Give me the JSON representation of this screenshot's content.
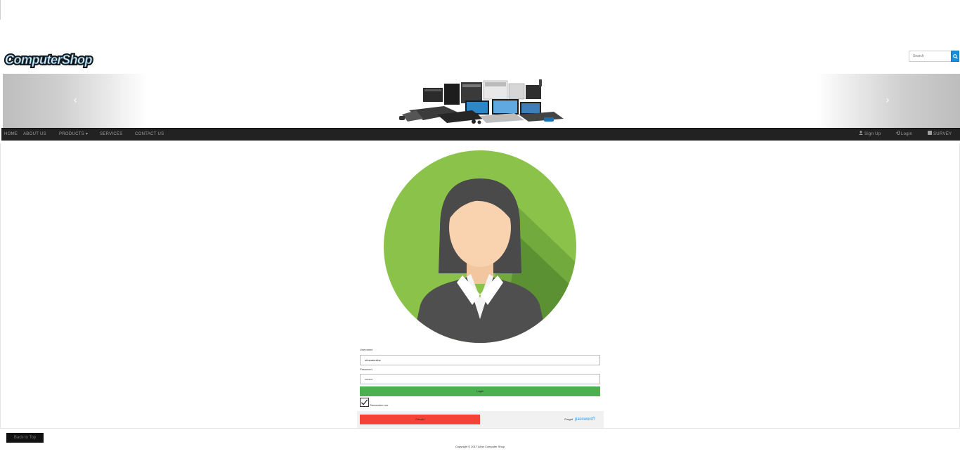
{
  "brand": {
    "logo_text": "ComputerShop"
  },
  "search": {
    "placeholder": "Search",
    "button_icon": "search-icon"
  },
  "carousel": {
    "prev_icon": "chevron-left-icon",
    "next_icon": "chevron-right-icon",
    "prev_glyph": "‹",
    "next_glyph": "›",
    "image": "computer-products-collage"
  },
  "navbar": {
    "left": [
      {
        "label": "HOME"
      },
      {
        "label": "ABOUT US"
      },
      {
        "label": "PRODUCTS ▾"
      },
      {
        "label": "SERVICES"
      },
      {
        "label": "CONTACT US"
      }
    ],
    "right": [
      {
        "label": "Sign Up",
        "icon": "user-icon"
      },
      {
        "label": "Login",
        "icon": "login-icon"
      },
      {
        "label": "SURVEY",
        "icon": "list-icon"
      }
    ]
  },
  "login": {
    "avatar": "woman-avatar",
    "username_label": "Username",
    "username_value": "ofmeateuline",
    "password_label": "Password",
    "password_value": "••••••••",
    "login_button": "Login",
    "remember_label": "Remember me",
    "remember_checked": true,
    "cancel_button": "Cancel",
    "forgot_text": "Forgot",
    "forgot_link": "password?"
  },
  "footer": {
    "back_to_top": "Back to Top",
    "copyright": "Copyright © 2017 Aline Computer Shop"
  },
  "colors": {
    "navbar": "#222222",
    "login_button": "#4caf50",
    "cancel_button": "#f44336",
    "link": "#2196F3",
    "search_button": "#1a8fd8",
    "avatar_bg": "#8bc34a"
  }
}
